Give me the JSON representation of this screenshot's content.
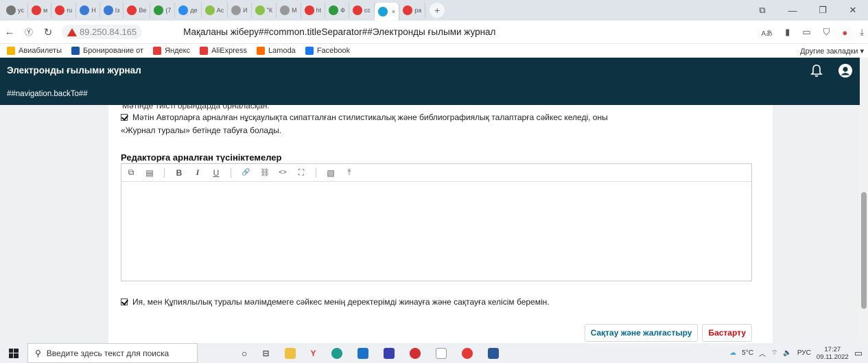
{
  "browser": {
    "tabs": [
      {
        "label": "yc",
        "color": "#777"
      },
      {
        "label": "м",
        "color": "#e53935"
      },
      {
        "label": "ru",
        "color": "#e53935"
      },
      {
        "label": "Н",
        "color": "#3a7bd5"
      },
      {
        "label": "Із",
        "color": "#3a7bd5"
      },
      {
        "label": "Ве",
        "color": "#e53935"
      },
      {
        "label": "(7",
        "color": "#2e9b3e"
      },
      {
        "label": "де",
        "color": "#2d8cf0"
      },
      {
        "label": "Ас",
        "color": "#8bc34a"
      },
      {
        "label": "И",
        "color": "#999"
      },
      {
        "label": "\"К",
        "color": "#8bc34a"
      },
      {
        "label": "М",
        "color": "#999"
      },
      {
        "label": "ht",
        "color": "#e53935"
      },
      {
        "label": "Ф",
        "color": "#2e9b3e"
      },
      {
        "label": "сс",
        "color": "#e53935"
      },
      {
        "label": "",
        "color": "#1aa3d9",
        "active": true
      },
      {
        "label": "ра",
        "color": "#e53935"
      }
    ],
    "new_tab_glyph": "+",
    "address": {
      "security_label": "",
      "ip": "89.250.84.165",
      "page_title": "Мақаланы жіберу##common.titleSeparator##Электронды ғылыми журнал"
    },
    "bookmarks": [
      {
        "label": "Авиабилеты",
        "color": "#f4b400"
      },
      {
        "label": "Бронирование от",
        "color": "#1a56a8"
      },
      {
        "label": "Яндекс",
        "color": "#e53935"
      },
      {
        "label": "AliExpress",
        "color": "#e53935"
      },
      {
        "label": "Lamoda",
        "color": "#ff6d00"
      },
      {
        "label": "Facebook",
        "color": "#1877f2"
      }
    ],
    "other_bookmarks": "Другие закладки ▾"
  },
  "app": {
    "title": "Электронды ғылыми журнал",
    "back_nav": "##navigation.backTo##"
  },
  "form": {
    "cutoff_text": "Мәтінде тиісті орындарда орналасқан.",
    "checklist_item_line1": "Мәтін Авторларға арналған нұсқаулықта сипатталған стилистикалық және библиографиялық талаптарға сәйкес келеді, оны",
    "checklist_item_line2": "«Журнал туралы» бетінде табуға болады.",
    "comments_title": "Редакторға арналған түсініктемелер",
    "toolbar": {
      "copy": "⧉",
      "paste": "▤",
      "bold": "B",
      "italic": "I",
      "underline": "U",
      "link": "🔗",
      "unlink": "⛓",
      "code": "<>",
      "fullscreen": "⛶",
      "image": "▧",
      "upload": "⤒"
    },
    "privacy_consent": "Ия, мен Құпиялылық туралы мәлімдемеге сәйкес менің деректерімді жинауға және сақтауға келісім беремін.",
    "save_button": "Сақтау және жалғастыру",
    "cancel_button": "Бастарту"
  },
  "taskbar": {
    "search_placeholder": "Введите здесь текст для поиска",
    "weather": "5°C",
    "language": "РУС",
    "time": "17:27",
    "date": "09.11.2022"
  }
}
